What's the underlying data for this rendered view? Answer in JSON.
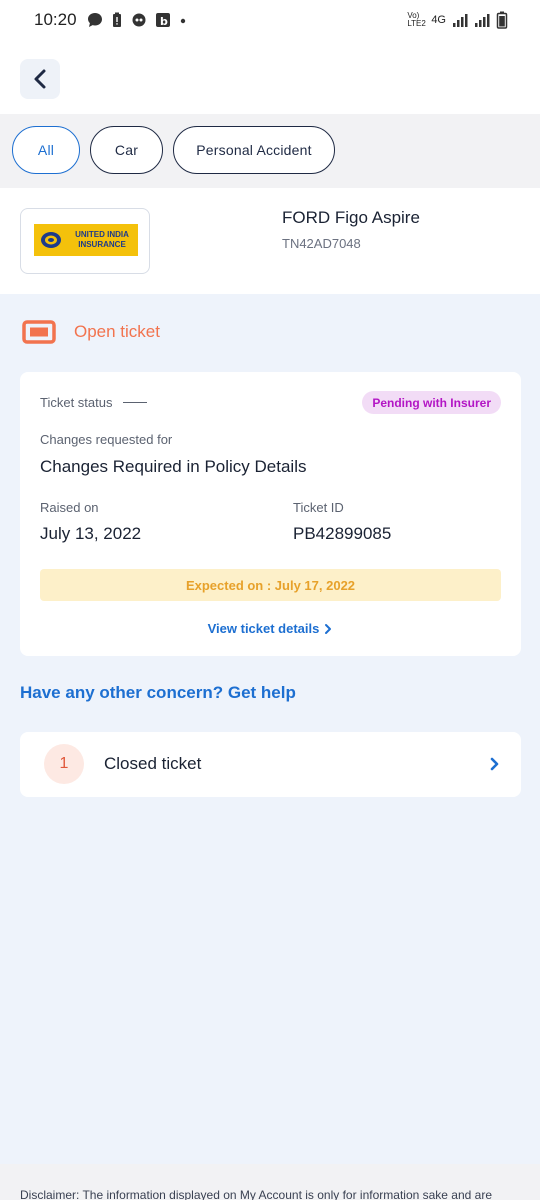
{
  "status_bar": {
    "time": "10:20",
    "network_label": "4G",
    "volte_label": "Vo) LTE2"
  },
  "header": {
    "back_icon": "chevron-left-icon"
  },
  "filters": {
    "tabs": [
      {
        "label": "All",
        "active": true
      },
      {
        "label": "Car",
        "active": false
      },
      {
        "label": "Personal Accident",
        "active": false
      }
    ]
  },
  "policy": {
    "insurer_logo_text": "UNITED INDIA INSURANCE",
    "vehicle_name": "FORD Figo Aspire",
    "registration": "TN42AD7048"
  },
  "open_ticket": {
    "label": "Open ticket",
    "icon": "ticket-icon"
  },
  "ticket": {
    "status_label": "Ticket status",
    "status_badge": "Pending with Insurer",
    "changes_label": "Changes requested for",
    "changes_value": "Changes Required in Policy Details",
    "raised_label": "Raised on",
    "raised_value": "July 13, 2022",
    "id_label": "Ticket ID",
    "id_value": "PB42899085",
    "expected": "Expected on : July 17, 2022",
    "view_details": "View ticket details"
  },
  "help": {
    "label": "Have any other concern? Get help"
  },
  "closed": {
    "count": "1",
    "label": "Closed ticket"
  },
  "disclaimer": {
    "text": "Disclaimer: The information displayed on My Account is only for information sake and are"
  },
  "colors": {
    "accent": "#1d6fd1",
    "open_ticket": "#f2734e",
    "badge_text": "#b316c5",
    "badge_bg": "#f2dcf6",
    "expected_text": "#e7a12a",
    "expected_bg": "#fdf0c9"
  }
}
